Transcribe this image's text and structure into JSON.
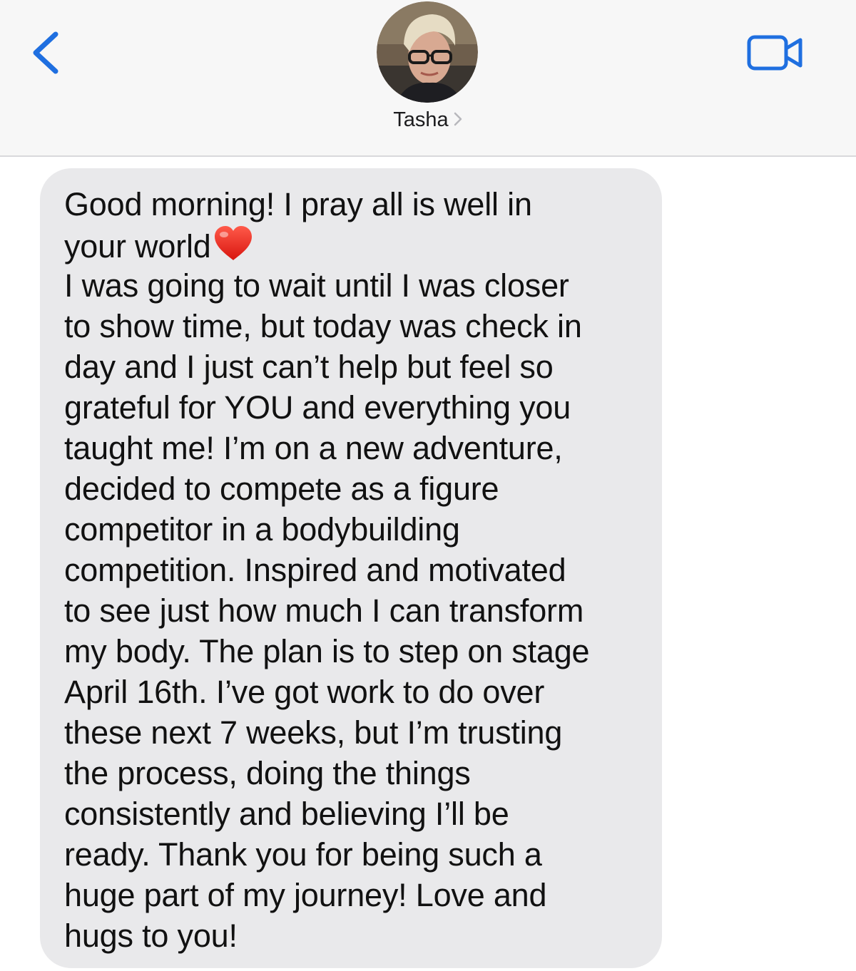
{
  "header": {
    "contact_name": "Tasha",
    "back_icon": "chevron-left-icon",
    "video_icon": "video-camera-icon",
    "accent_color": "#1f6fe0"
  },
  "message": {
    "direction": "incoming",
    "bubble_color": "#e9e9eb",
    "emoji": "red-heart",
    "lines": [
      "Good morning! I pray all is well in",
      "your world",
      "I was going to wait until I was closer",
      "to show time, but today was check in",
      "day and I just can’t help but feel so",
      "grateful for YOU and everything you",
      "taught me! I’m on a new adventure,",
      "decided to compete as a figure",
      "competitor in a bodybuilding",
      "competition. Inspired and motivated",
      "to see just how much I can transform",
      "my body. The plan is to step on stage",
      "April 16th. I’ve got work to do over",
      "these next 7 weeks, but I’m trusting",
      "the process, doing the things",
      "consistently and believing I’ll be",
      "ready. Thank you for being such a",
      "huge part of my journey! Love and",
      "hugs to you!"
    ]
  }
}
